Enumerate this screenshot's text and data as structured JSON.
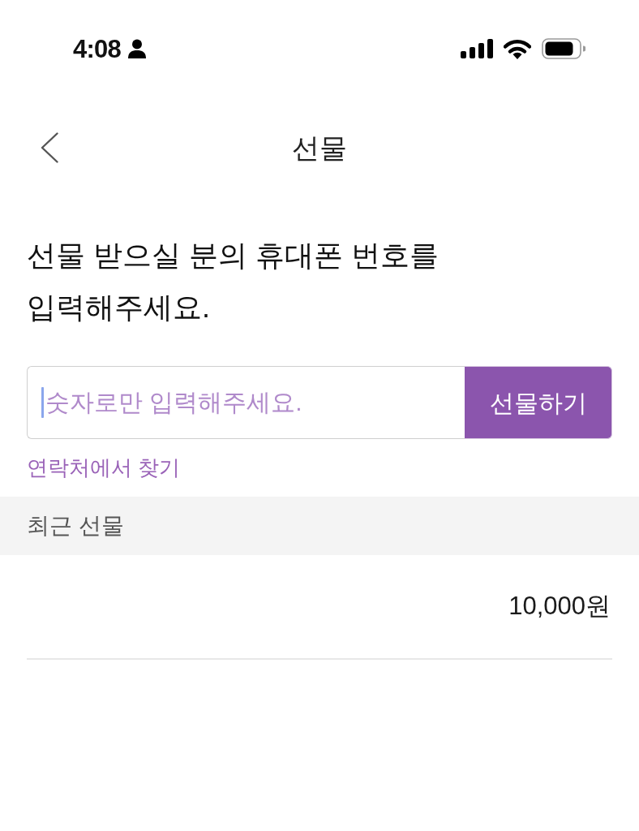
{
  "status_bar": {
    "time": "4:08"
  },
  "header": {
    "title": "선물"
  },
  "prompt": "선물 받으실 분의 휴대폰 번호를\n입력해주세요.",
  "phone_field": {
    "placeholder": "숫자로만 입력해주세요.",
    "focused": true
  },
  "submit_button": {
    "label": "선물하기"
  },
  "contacts_link": {
    "label": "연락처에서 찾기"
  },
  "recent_section": {
    "title": "최근 선물",
    "items": [
      {
        "amount": "10,000원"
      }
    ]
  }
}
